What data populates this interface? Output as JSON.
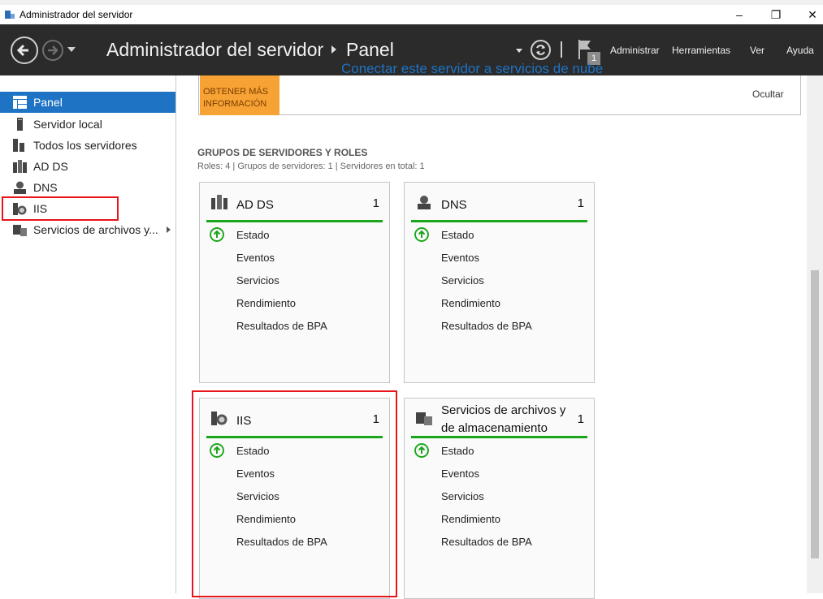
{
  "window": {
    "title": "Administrador del servidor",
    "controls": {
      "minimize": "–",
      "maximize": "❐",
      "close": "✕"
    }
  },
  "header": {
    "breadcrumb_root": "Administrador del servidor",
    "breadcrumb_current": "Panel",
    "notification_count": "1",
    "menu": [
      "Administrar",
      "Herramientas",
      "Ver",
      "Ayuda"
    ]
  },
  "sidebar": {
    "items": [
      {
        "label": "Panel",
        "icon": "dashboard-icon",
        "active": true
      },
      {
        "label": "Servidor local",
        "icon": "server-icon"
      },
      {
        "label": "Todos los servidores",
        "icon": "servers-icon"
      },
      {
        "label": "AD DS",
        "icon": "adds-icon"
      },
      {
        "label": "DNS",
        "icon": "dns-icon"
      },
      {
        "label": "IIS",
        "icon": "iis-icon"
      },
      {
        "label": "Servicios de archivos y...",
        "icon": "file-services-icon",
        "has_submenu": true
      }
    ]
  },
  "welcome": {
    "learn_more": "OBTENER MÁS INFORMACIÓN",
    "cloud_link": "Conectar este servidor a servicios de nube",
    "hide": "Ocultar"
  },
  "roles": {
    "title": "GRUPOS DE SERVIDORES Y ROLES",
    "summary": "Roles: 4   |   Grupos de servidores: 1   |   Servidores en total: 1",
    "tiles": [
      {
        "title": "AD DS",
        "count": "1",
        "icon": "adds-icon",
        "rows": [
          "Estado",
          "Eventos",
          "Servicios",
          "Rendimiento",
          "Resultados de BPA"
        ]
      },
      {
        "title": "DNS",
        "count": "1",
        "icon": "dns-icon",
        "rows": [
          "Estado",
          "Eventos",
          "Servicios",
          "Rendimiento",
          "Resultados de BPA"
        ]
      },
      {
        "title": "IIS",
        "count": "1",
        "icon": "iis-icon",
        "rows": [
          "Estado",
          "Eventos",
          "Servicios",
          "Rendimiento",
          "Resultados de BPA"
        ]
      },
      {
        "title": "Servicios de archivos y de almacenamiento",
        "count": "1",
        "icon": "file-services-icon",
        "rows": [
          "Estado",
          "Eventos",
          "Servicios",
          "Rendimiento",
          "Resultados de BPA"
        ]
      }
    ]
  },
  "colors": {
    "header_bg": "#2b2b2b",
    "active_nav": "#1f73c4",
    "status_green": "#1aa51a",
    "learn_more": "#f7a234",
    "annotation_red": "#e8141b"
  }
}
